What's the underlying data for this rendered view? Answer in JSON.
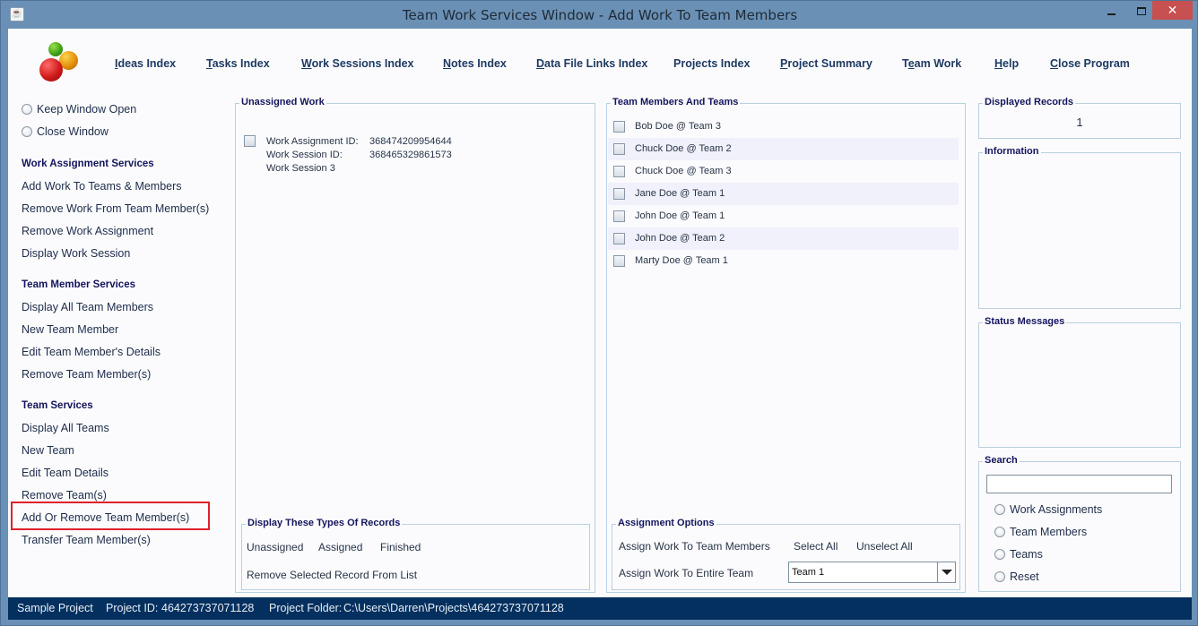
{
  "window": {
    "title": "Team Work Services Window - Add Work To Team Members",
    "app_icon": "java-cup-icon",
    "controls": {
      "minimize": "minimize",
      "maximize": "maximize",
      "close": "✕"
    }
  },
  "logo": {
    "icon": "three-balls-logo"
  },
  "nav": {
    "items": [
      {
        "label": "Ideas Index",
        "mnemonic": "I"
      },
      {
        "label": "Tasks Index",
        "mnemonic": "T"
      },
      {
        "label": "Work Sessions Index",
        "mnemonic": "W"
      },
      {
        "label": "Notes Index",
        "mnemonic": "N"
      },
      {
        "label": "Data File Links Index",
        "mnemonic": "D"
      },
      {
        "label": "Projects Index",
        "mnemonic": ""
      },
      {
        "label": "Project Summary",
        "mnemonic": "P"
      },
      {
        "label": "Team Work",
        "mnemonic": "e"
      },
      {
        "label": "Help",
        "mnemonic": "H"
      },
      {
        "label": "Close Program",
        "mnemonic": "C"
      }
    ]
  },
  "sidebar": {
    "window_options": [
      {
        "label": "Keep Window Open",
        "selected": false
      },
      {
        "label": "Close Window",
        "selected": false
      }
    ],
    "sections": [
      {
        "heading": "Work Assignment Services",
        "items": [
          "Add Work To Teams & Members",
          "Remove Work From Team Member(s)",
          "Remove Work Assignment",
          "Display Work Session"
        ]
      },
      {
        "heading": "Team Member Services",
        "items": [
          "Display All Team Members",
          "New Team Member",
          "Edit Team Member's Details",
          "Remove Team Member(s)"
        ]
      },
      {
        "heading": "Team Services",
        "items": [
          "Display All Teams",
          "New Team",
          "Edit Team Details",
          "Remove Team(s)",
          "Add Or Remove Team Member(s)",
          "Transfer Team Member(s)"
        ]
      }
    ],
    "highlighted_item": "Add Or Remove Team Member(s)",
    "highlight_color": "#e0212a"
  },
  "unassigned_work": {
    "title": "Unassigned Work",
    "records": [
      {
        "checked": false,
        "assignment_id_label": "Work Assignment ID:",
        "assignment_id": "368474209954644",
        "session_id_label": "Work Session ID:",
        "session_id": "368465329861573",
        "session_name": "Work Session 3"
      }
    ]
  },
  "display_types": {
    "title": "Display These Types Of Records",
    "options": [
      "Unassigned",
      "Assigned",
      "Finished"
    ],
    "remove_label": "Remove Selected Record From List"
  },
  "team_members": {
    "title": "Team Members And Teams",
    "items": [
      {
        "label": "Bob Doe @ Team 3",
        "checked": false
      },
      {
        "label": "Chuck Doe @ Team 2",
        "checked": false
      },
      {
        "label": "Chuck Doe @ Team 3",
        "checked": false
      },
      {
        "label": "Jane Doe @ Team 1",
        "checked": false
      },
      {
        "label": "John Doe @ Team 1",
        "checked": false
      },
      {
        "label": "John Doe @ Team 2",
        "checked": false
      },
      {
        "label": "Marty Doe @ Team 1",
        "checked": false
      }
    ]
  },
  "assignment_options": {
    "title": "Assignment Options",
    "assign_members_label": "Assign Work To Team Members",
    "select_all_label": "Select All",
    "unselect_all_label": "Unselect All",
    "assign_team_label": "Assign Work To Entire Team",
    "team_selected": "Team 1"
  },
  "displayed_records": {
    "title": "Displayed Records",
    "count": "1"
  },
  "information": {
    "title": "Information",
    "text": ""
  },
  "status_messages": {
    "title": "Status Messages",
    "text": ""
  },
  "search": {
    "title": "Search",
    "value": "",
    "placeholder": "",
    "options": [
      {
        "label": "Work Assignments",
        "selected": false
      },
      {
        "label": "Team Members",
        "selected": false
      },
      {
        "label": "Teams",
        "selected": false
      },
      {
        "label": "Reset",
        "selected": false
      }
    ]
  },
  "statusbar": {
    "project_name": "Sample Project",
    "project_id_label": "Project ID:",
    "project_id": "464273737071128",
    "project_folder_label": "Project Folder:",
    "project_folder": "C:\\Users\\Darren\\Projects\\464273737071128"
  },
  "colors": {
    "window_frame": "#6a90b5",
    "close_button": "#c75050",
    "statusbar_bg": "#03305f",
    "heading_text": "#14155c",
    "group_border": "#b9d0df"
  }
}
